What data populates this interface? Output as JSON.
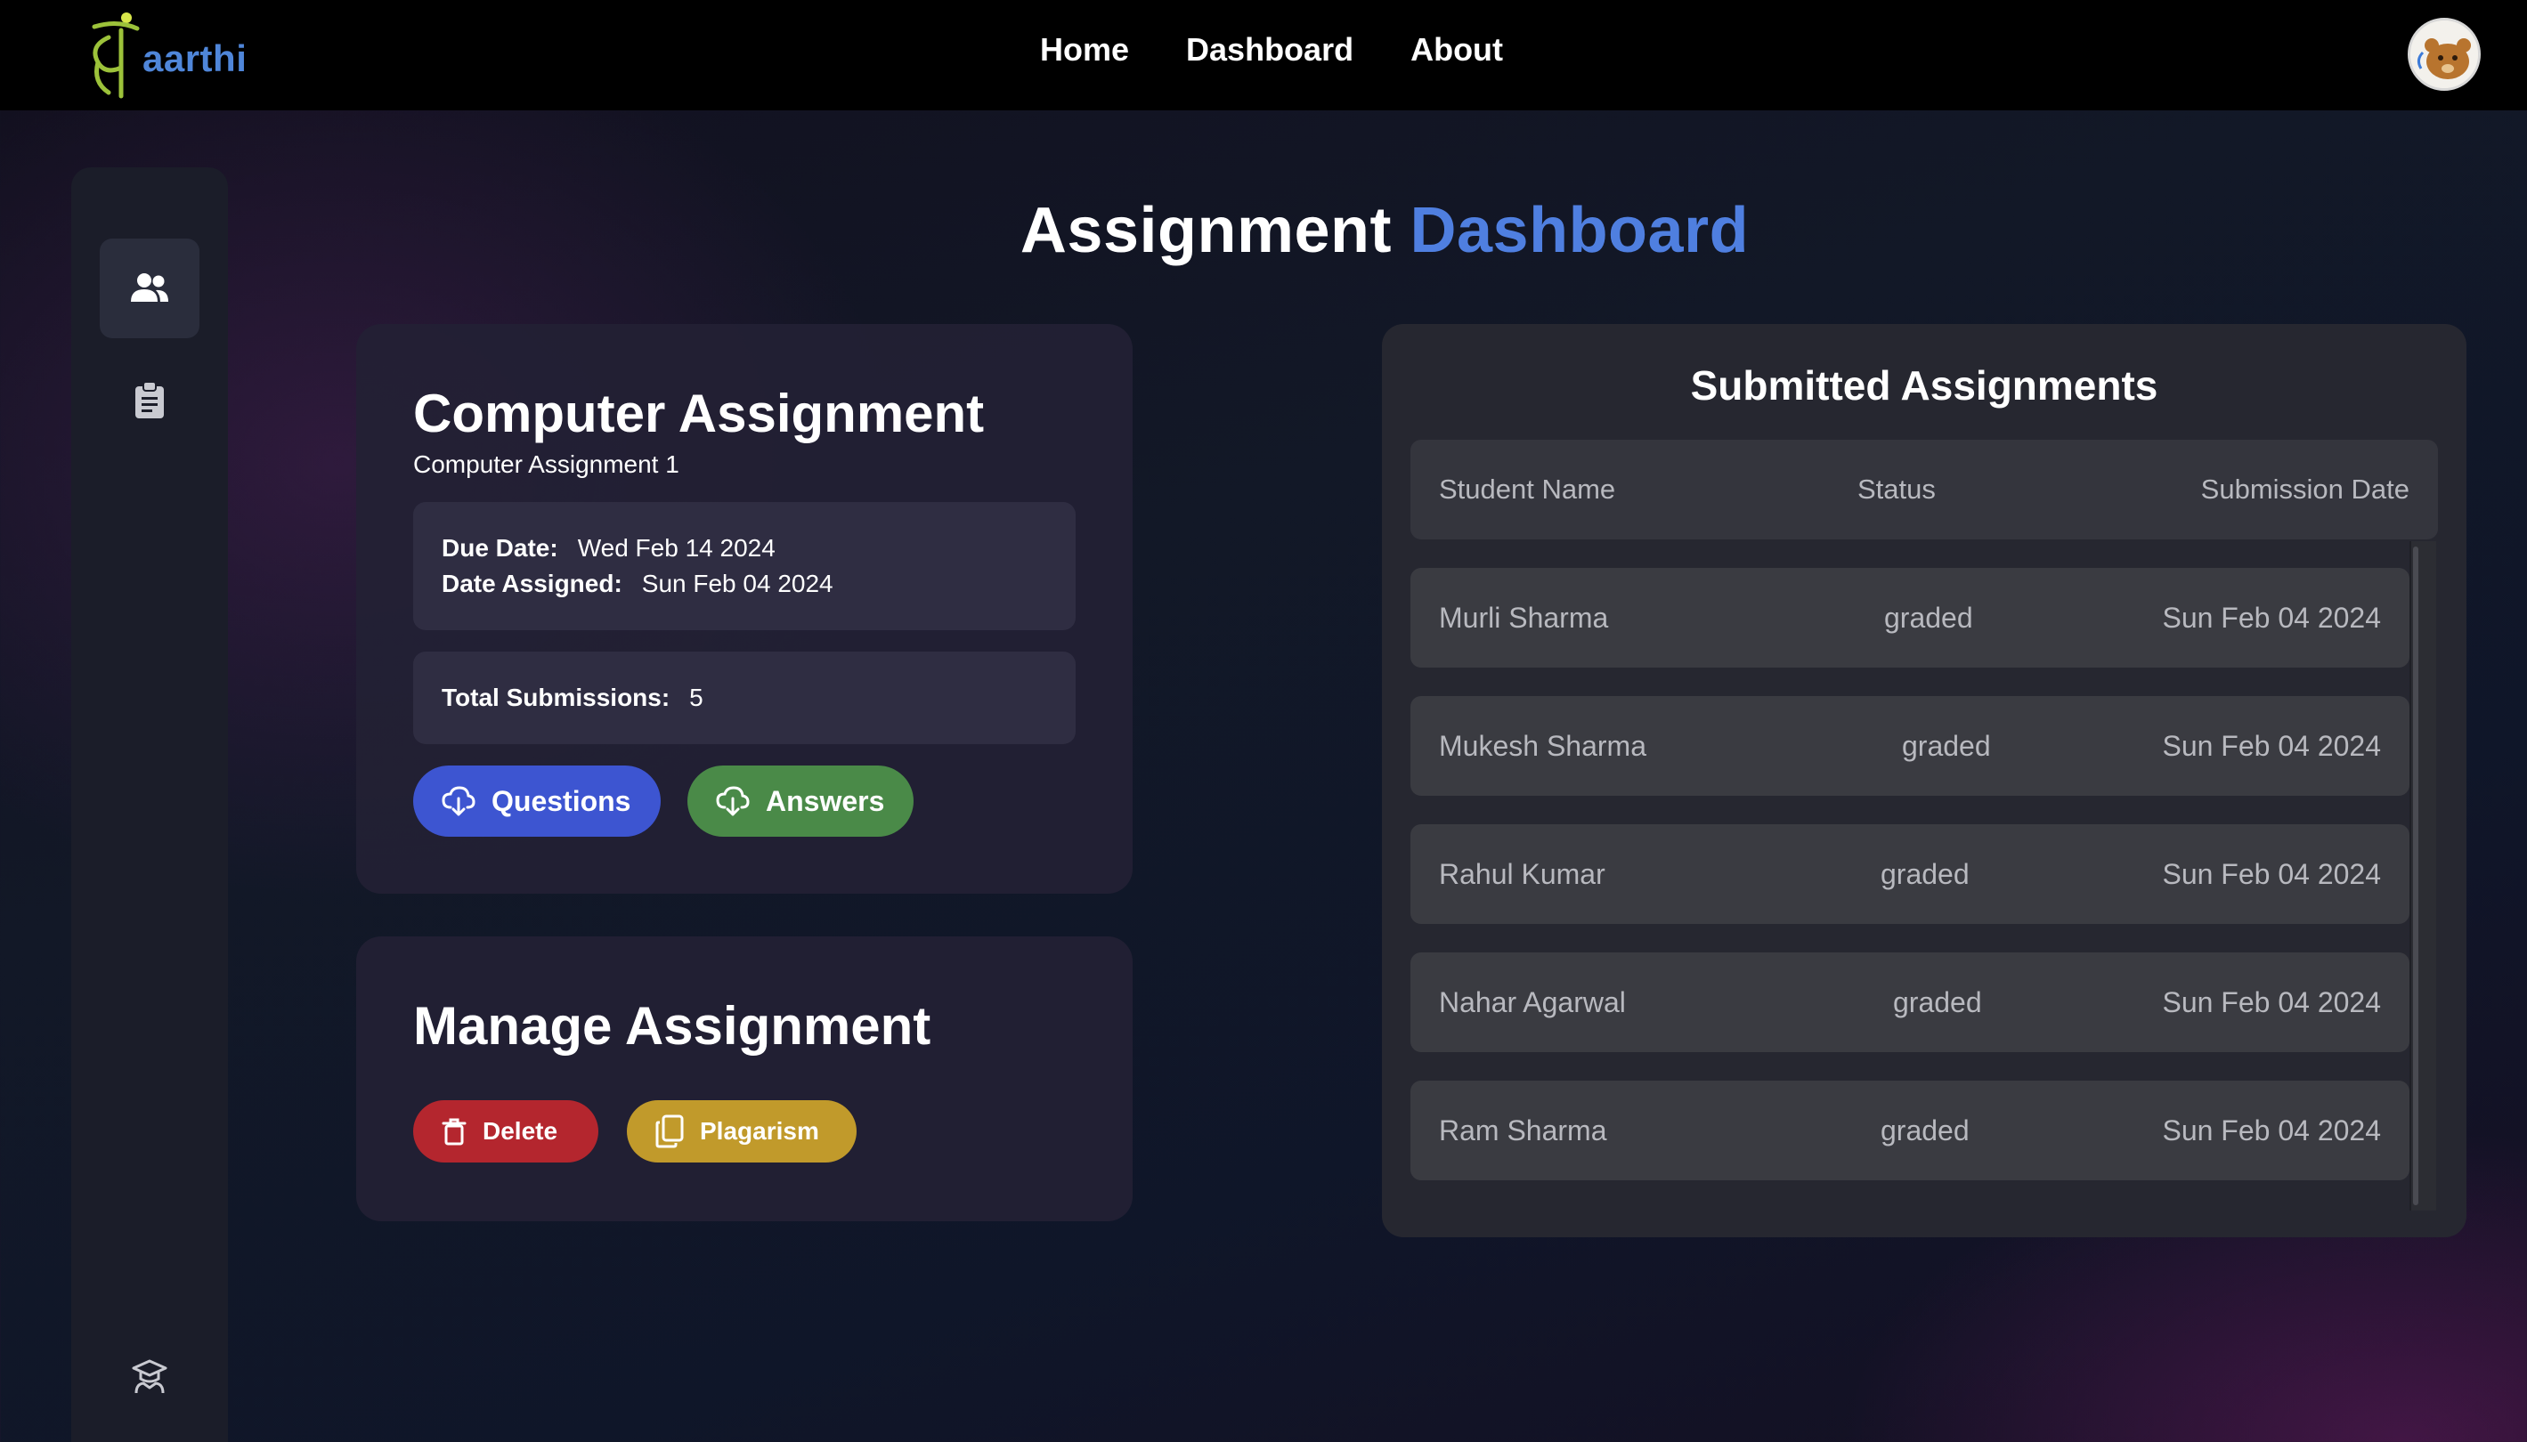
{
  "brand": {
    "logo_text": "aarthi"
  },
  "nav": {
    "items": [
      "Home",
      "Dashboard",
      "About"
    ]
  },
  "sidebar": {
    "items": [
      "users-icon",
      "clipboard-icon",
      "graduate-icon"
    ]
  },
  "page_title": {
    "main": "Assignment",
    "accent": "Dashboard"
  },
  "assignment": {
    "title": "Computer Assignment",
    "subtitle": "Computer Assignment 1",
    "due_label": "Due Date:",
    "due_value": "Wed Feb 14 2024",
    "assigned_label": "Date Assigned:",
    "assigned_value": "Sun Feb 04 2024",
    "submissions_label": "Total Submissions:",
    "submissions_value": "5",
    "questions_label": "Questions",
    "answers_label": "Answers"
  },
  "manage": {
    "title": "Manage Assignment",
    "delete_label": "Delete",
    "plagiarism_label": "Plagarism"
  },
  "submitted": {
    "title": "Submitted Assignments",
    "columns": [
      "Student Name",
      "Status",
      "Submission Date"
    ],
    "rows": [
      {
        "name": "Murli Sharma",
        "status": "graded",
        "date": "Sun Feb 04 2024"
      },
      {
        "name": "Mukesh Sharma",
        "status": "graded",
        "date": "Sun Feb 04 2024"
      },
      {
        "name": "Rahul Kumar",
        "status": "graded",
        "date": "Sun Feb 04 2024"
      },
      {
        "name": "Nahar Agarwal",
        "status": "graded",
        "date": "Sun Feb 04 2024"
      },
      {
        "name": "Ram Sharma",
        "status": "graded",
        "date": "Sun Feb 04 2024"
      }
    ]
  },
  "colors": {
    "accent": "#4f7fe0",
    "questions": "#3d55d1",
    "answers": "#4a8a48",
    "delete": "#b4262e",
    "plagiarism": "#c19a2b"
  }
}
